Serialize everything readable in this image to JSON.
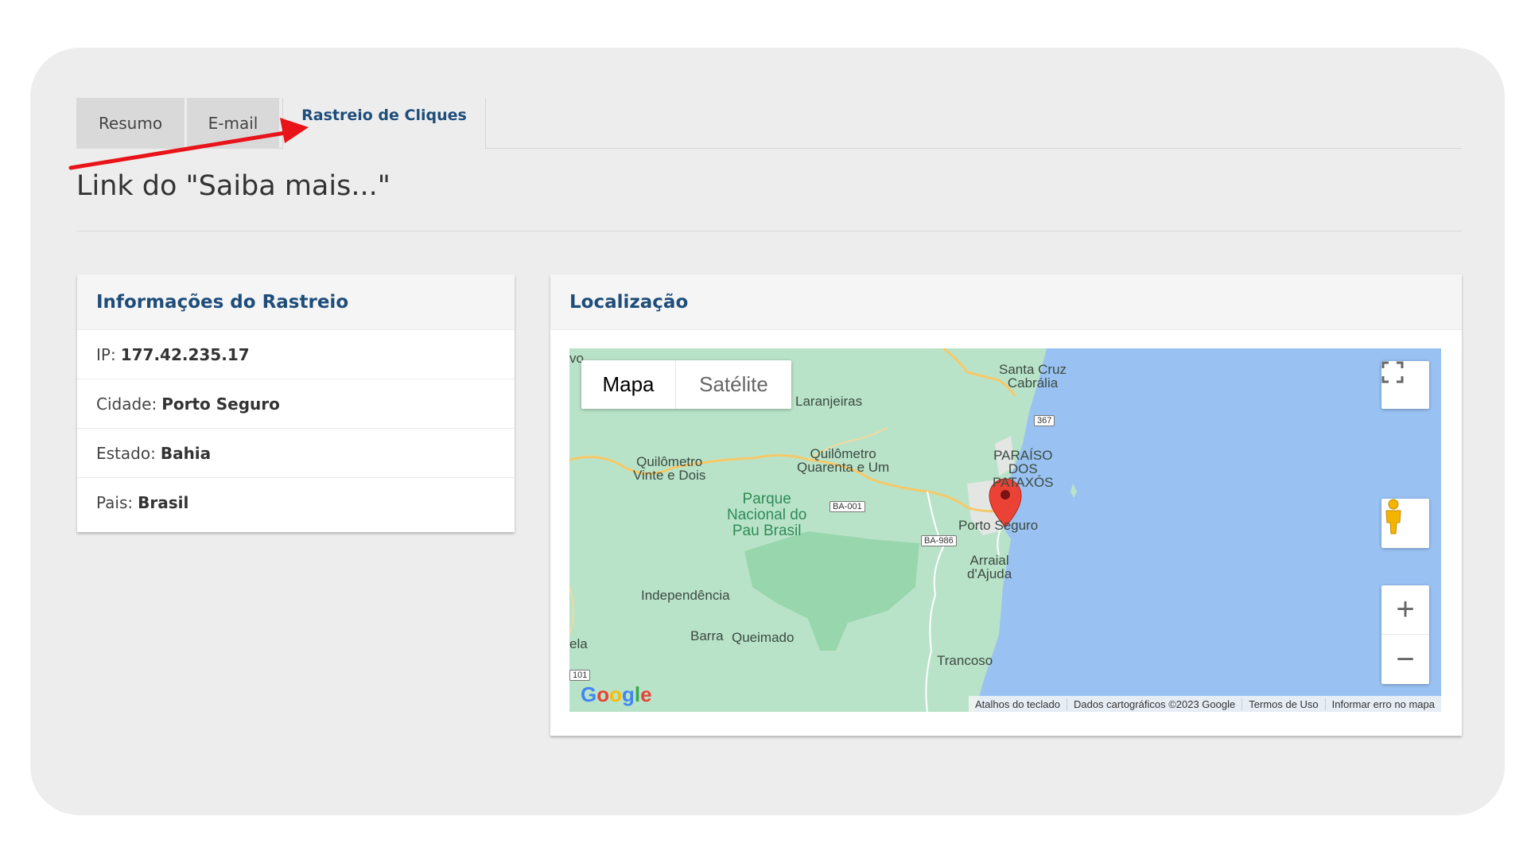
{
  "tabs": [
    {
      "label": "Resumo"
    },
    {
      "label": "E-mail"
    },
    {
      "label": "Rastreio de Cliques"
    }
  ],
  "page_title": "Link do \"Saiba mais...\"",
  "info_panel": {
    "title": "Informações do Rastreio",
    "rows": [
      {
        "label": "IP:",
        "value": "177.42.235.17"
      },
      {
        "label": "Cidade:",
        "value": "Porto Seguro"
      },
      {
        "label": "Estado:",
        "value": "Bahia"
      },
      {
        "label": "Pais:",
        "value": "Brasil"
      }
    ]
  },
  "map_panel": {
    "title": "Localização",
    "map_type": {
      "map": "Mapa",
      "satellite": "Satélite"
    },
    "zoom_in": "+",
    "zoom_out": "−",
    "labels": {
      "santa_cruz": "Santa Cruz\nCabrália",
      "laranjeiras": "Laranjeiras",
      "paraiso": "PARAÍSO\nDOS\nPATAXÓS",
      "quilometro22": "Quilômetro\nVinte e Dois",
      "quilometro41": "Quilômetro\nQuarenta e Um",
      "parque": "Parque\nNacional do\nPau Brasil",
      "porto_seguro": "Porto Seguro",
      "arraial": "Arraial\nd'Ajuda",
      "independencia": "Independência",
      "barra": "Barra",
      "queimado": "Queimado",
      "trancoso": "Trancoso",
      "ela": "ela",
      "vo": "vo"
    },
    "road_badges": {
      "r367": "367",
      "ba001": "BA-001",
      "ba986": "BA-986",
      "r101": "101"
    },
    "google": "Google",
    "attribution": [
      "Atalhos do teclado",
      "Dados cartográficos ©2023 Google",
      "Termos de Uso",
      "Informar erro no mapa"
    ]
  },
  "colors": {
    "accent": "#1e4d7a",
    "map_land": "#b9e3c8",
    "map_water": "#99c2f3",
    "marker": "#ea4335",
    "annotation_arrow": "#e8141a"
  }
}
